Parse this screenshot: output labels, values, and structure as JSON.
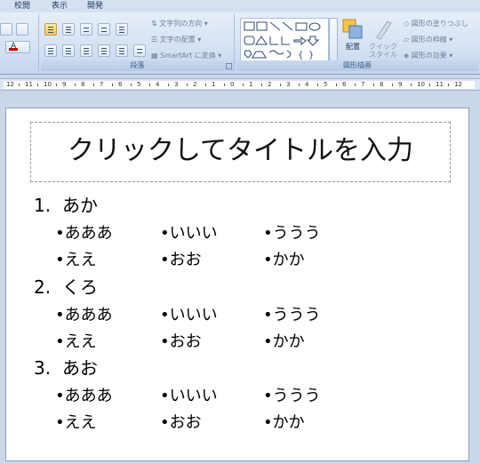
{
  "tabs": [
    "校閲",
    "表示",
    "開発"
  ],
  "ribbon": {
    "paragraph_group_label": "段落",
    "text_direction_label": "文字列の方向",
    "align_text_label": "文字の配置",
    "smartart_label": "SmartArt に変換",
    "drawing_group_label": "図形描画",
    "arrange_label": "配置",
    "quick_style_label": "クイック スタイル",
    "shape_fill_label": "図形の塗りつぶし",
    "shape_outline_label": "図形の枠線",
    "shape_effects_label": "図形の効果"
  },
  "ruler": {
    "ticks": [
      "12",
      "11",
      "10",
      "9",
      "8",
      "7",
      "6",
      "5",
      "4",
      "3",
      "2",
      "1",
      "0",
      "1",
      "2",
      "3",
      "4",
      "5",
      "6",
      "7",
      "8",
      "9",
      "10",
      "11",
      "12"
    ]
  },
  "slide": {
    "title_placeholder": "クリックしてタイトルを入力",
    "items": [
      {
        "number": "1.",
        "label": "あか",
        "rows": [
          [
            "•あああ",
            "•いいい",
            "•ううう"
          ],
          [
            "•ええ",
            "•おお",
            "•かか"
          ]
        ]
      },
      {
        "number": "2.",
        "label": "くろ",
        "rows": [
          [
            "•あああ",
            "•いいい",
            "•ううう"
          ],
          [
            "•ええ",
            "•おお",
            "•かか"
          ]
        ]
      },
      {
        "number": "3.",
        "label": "あお",
        "rows": [
          [
            "•あああ",
            "•いいい",
            "•ううう"
          ],
          [
            "•ええ",
            "•おお",
            "•かか"
          ]
        ]
      }
    ]
  }
}
